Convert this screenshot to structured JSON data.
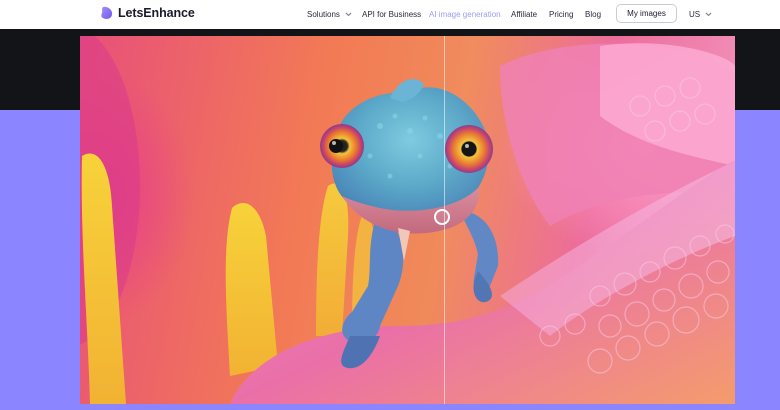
{
  "brand": {
    "name": "LetsEnhance",
    "logo_icon": "letsenhance-logo-icon",
    "logo_color": "#8b7cf6"
  },
  "nav": {
    "items": [
      {
        "label": "Solutions",
        "has_dropdown": true,
        "active": false
      },
      {
        "label": "API for Business",
        "has_dropdown": false,
        "active": false
      },
      {
        "label": "AI image generation",
        "has_dropdown": false,
        "active": true
      },
      {
        "label": "Affiliate",
        "has_dropdown": false,
        "active": false
      },
      {
        "label": "Pricing",
        "has_dropdown": false,
        "active": false
      },
      {
        "label": "Blog",
        "has_dropdown": false,
        "active": false
      }
    ],
    "my_images_label": "My images",
    "language_label": "US"
  },
  "hero": {
    "comparison": {
      "subject": "chameleon on flower petal",
      "slider_position": 0.556,
      "handle_icon": "circle-handle-icon"
    }
  },
  "colors": {
    "dark_band": "#131418",
    "accent_band": "#8b85ff",
    "active_nav": "#9aa0f2"
  }
}
